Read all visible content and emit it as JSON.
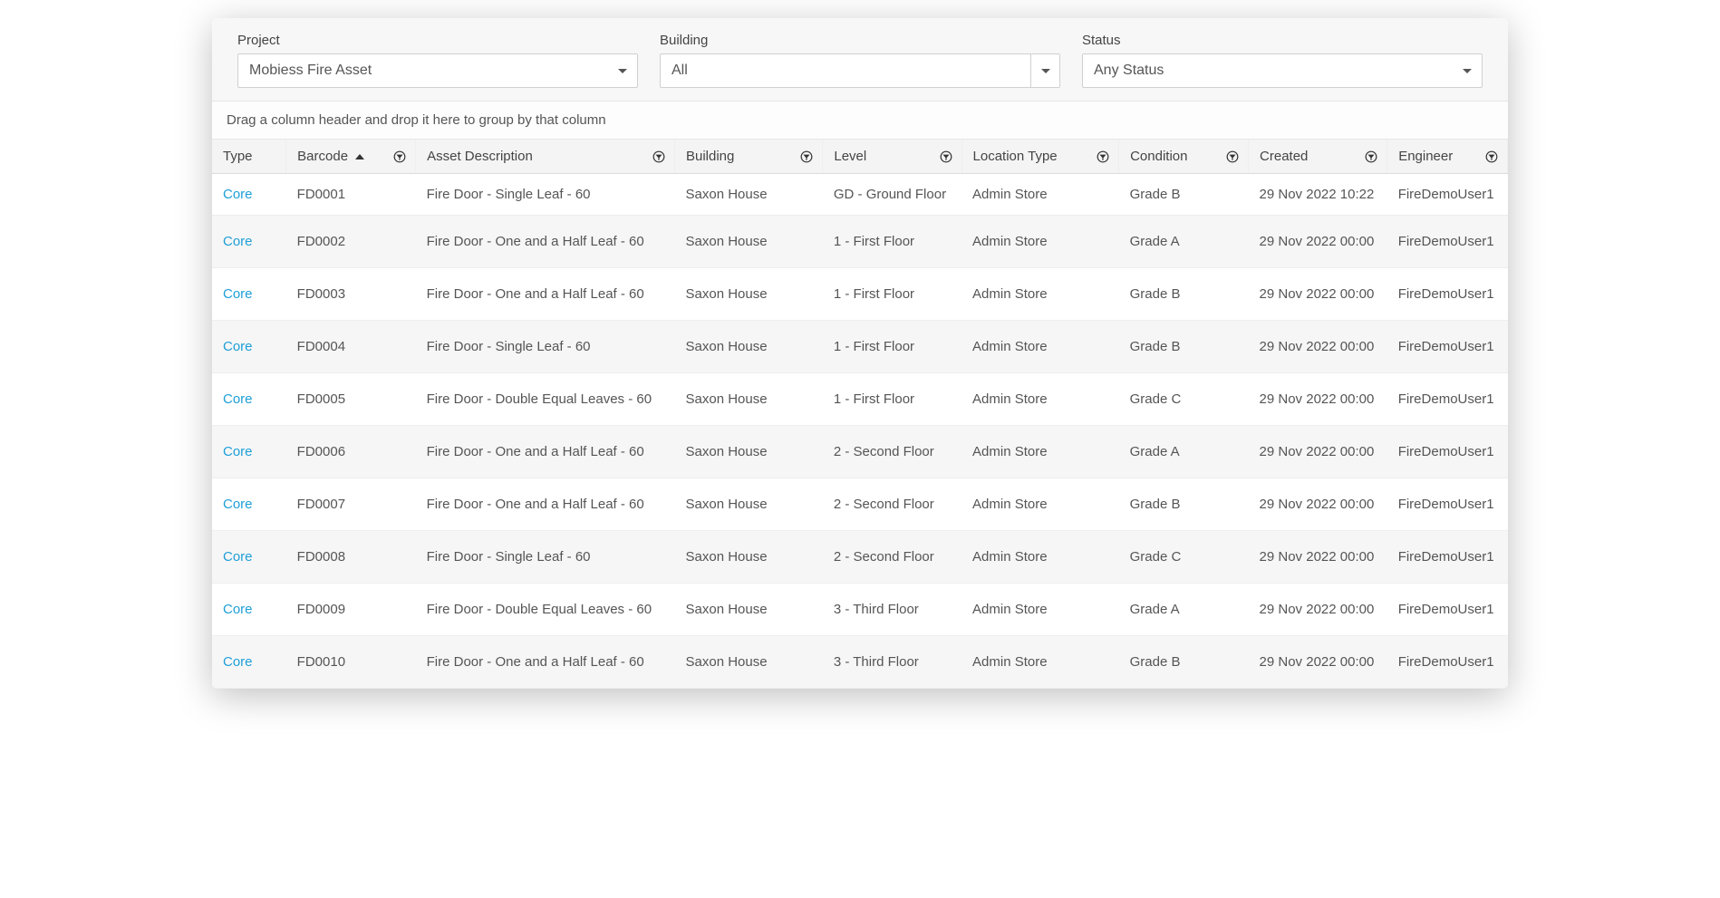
{
  "filters": {
    "project": {
      "label": "Project",
      "value": "Mobiess Fire Asset"
    },
    "building": {
      "label": "Building",
      "value": "All"
    },
    "status": {
      "label": "Status",
      "value": "Any Status"
    }
  },
  "group_bar": "Drag a column header and drop it here to group by that column",
  "columns": {
    "type": "Type",
    "barcode": "Barcode",
    "desc": "Asset Description",
    "building": "Building",
    "level": "Level",
    "loctype": "Location Type",
    "cond": "Condition",
    "created": "Created",
    "eng": "Engineer"
  },
  "rows": [
    {
      "type": "Core",
      "barcode": "FD0001",
      "desc": "Fire Door - Single Leaf - 60",
      "building": "Saxon House",
      "level": "GD - Ground Floor",
      "loctype": "Admin Store",
      "cond": "Grade B",
      "created": "29 Nov 2022 10:22",
      "eng": "FireDemoUser1"
    },
    {
      "type": "Core",
      "barcode": "FD0002",
      "desc": "Fire Door - One and a Half Leaf - 60",
      "building": "Saxon House",
      "level": "1 - First Floor",
      "loctype": "Admin Store",
      "cond": "Grade A",
      "created": "29 Nov 2022 00:00",
      "eng": "FireDemoUser1"
    },
    {
      "type": "Core",
      "barcode": "FD0003",
      "desc": "Fire Door - One and a Half Leaf - 60",
      "building": "Saxon House",
      "level": "1 - First Floor",
      "loctype": "Admin Store",
      "cond": "Grade B",
      "created": "29 Nov 2022 00:00",
      "eng": "FireDemoUser1"
    },
    {
      "type": "Core",
      "barcode": "FD0004",
      "desc": "Fire Door - Single Leaf - 60",
      "building": "Saxon House",
      "level": "1 - First Floor",
      "loctype": "Admin Store",
      "cond": "Grade B",
      "created": "29 Nov 2022 00:00",
      "eng": "FireDemoUser1"
    },
    {
      "type": "Core",
      "barcode": "FD0005",
      "desc": "Fire Door - Double Equal Leaves - 60",
      "building": "Saxon House",
      "level": "1 - First Floor",
      "loctype": "Admin Store",
      "cond": "Grade C",
      "created": "29 Nov 2022 00:00",
      "eng": "FireDemoUser1"
    },
    {
      "type": "Core",
      "barcode": "FD0006",
      "desc": "Fire Door - One and a Half Leaf - 60",
      "building": "Saxon House",
      "level": "2 - Second Floor",
      "loctype": "Admin Store",
      "cond": "Grade A",
      "created": "29 Nov 2022 00:00",
      "eng": "FireDemoUser1"
    },
    {
      "type": "Core",
      "barcode": "FD0007",
      "desc": "Fire Door - One and a Half Leaf - 60",
      "building": "Saxon House",
      "level": "2 - Second Floor",
      "loctype": "Admin Store",
      "cond": "Grade B",
      "created": "29 Nov 2022 00:00",
      "eng": "FireDemoUser1"
    },
    {
      "type": "Core",
      "barcode": "FD0008",
      "desc": "Fire Door - Single Leaf - 60",
      "building": "Saxon House",
      "level": "2 - Second Floor",
      "loctype": "Admin Store",
      "cond": "Grade C",
      "created": "29 Nov 2022 00:00",
      "eng": "FireDemoUser1"
    },
    {
      "type": "Core",
      "barcode": "FD0009",
      "desc": "Fire Door - Double Equal Leaves - 60",
      "building": "Saxon House",
      "level": "3 - Third Floor",
      "loctype": "Admin Store",
      "cond": "Grade A",
      "created": "29 Nov 2022 00:00",
      "eng": "FireDemoUser1"
    },
    {
      "type": "Core",
      "barcode": "FD0010",
      "desc": "Fire Door - One and a Half Leaf - 60",
      "building": "Saxon House",
      "level": "3 - Third Floor",
      "loctype": "Admin Store",
      "cond": "Grade B",
      "created": "29 Nov 2022 00:00",
      "eng": "FireDemoUser1"
    }
  ]
}
